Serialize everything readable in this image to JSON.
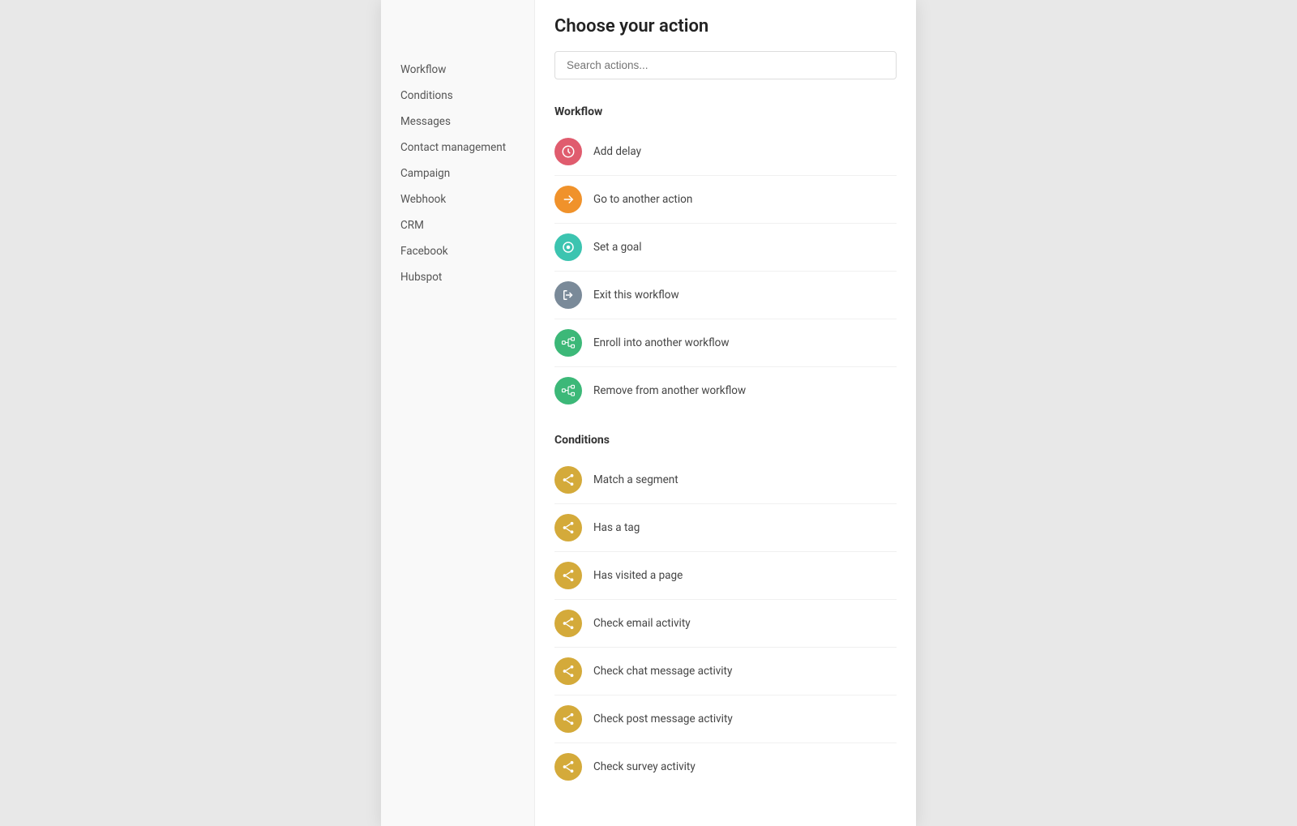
{
  "modal": {
    "title": "Choose your action",
    "search_placeholder": "Search actions..."
  },
  "sidebar": {
    "items": [
      {
        "label": "Workflow"
      },
      {
        "label": "Conditions"
      },
      {
        "label": "Messages"
      },
      {
        "label": "Contact management"
      },
      {
        "label": "Campaign"
      },
      {
        "label": "Webhook"
      },
      {
        "label": "CRM"
      },
      {
        "label": "Facebook"
      },
      {
        "label": "Hubspot"
      }
    ]
  },
  "sections": [
    {
      "title": "Workflow",
      "items": [
        {
          "label": "Add delay",
          "icon_type": "red",
          "icon_symbol": "clock"
        },
        {
          "label": "Go to another action",
          "icon_type": "orange",
          "icon_symbol": "arrow"
        },
        {
          "label": "Set a goal",
          "icon_type": "teal",
          "icon_symbol": "target"
        },
        {
          "label": "Exit this workflow",
          "icon_type": "gray",
          "icon_symbol": "exit"
        },
        {
          "label": "Enroll into another workflow",
          "icon_type": "green",
          "icon_symbol": "workflow"
        },
        {
          "label": "Remove from another workflow",
          "icon_type": "green",
          "icon_symbol": "workflow2"
        }
      ]
    },
    {
      "title": "Conditions",
      "items": [
        {
          "label": "Match a segment",
          "icon_type": "yellow",
          "icon_symbol": "share"
        },
        {
          "label": "Has a tag",
          "icon_type": "yellow",
          "icon_symbol": "share"
        },
        {
          "label": "Has visited a page",
          "icon_type": "yellow",
          "icon_symbol": "share"
        },
        {
          "label": "Check email activity",
          "icon_type": "yellow",
          "icon_symbol": "share"
        },
        {
          "label": "Check chat message activity",
          "icon_type": "yellow",
          "icon_symbol": "share"
        },
        {
          "label": "Check post message activity",
          "icon_type": "yellow",
          "icon_symbol": "share"
        },
        {
          "label": "Check survey activity",
          "icon_type": "yellow",
          "icon_symbol": "share"
        }
      ]
    }
  ]
}
